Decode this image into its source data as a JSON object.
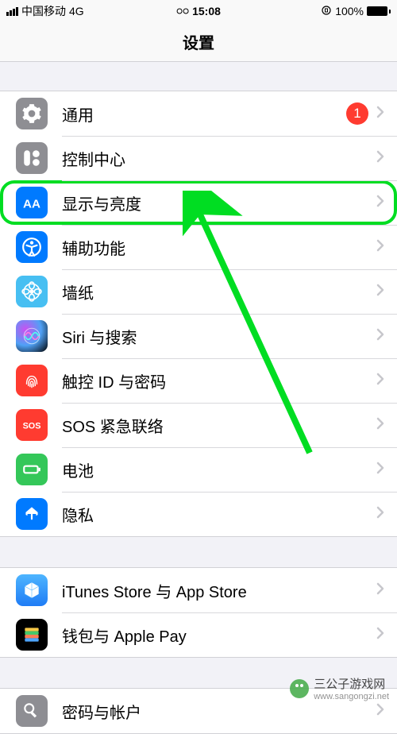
{
  "statusBar": {
    "carrier": "中国移动",
    "network": "4G",
    "time": "15:08",
    "battery_text": "100%"
  },
  "nav": {
    "title": "设置"
  },
  "groups": [
    {
      "items": [
        {
          "id": "general",
          "label": "通用",
          "badge": "1",
          "iconColor": "bg-gray"
        },
        {
          "id": "control-center",
          "label": "控制中心",
          "iconColor": "bg-gray"
        },
        {
          "id": "display",
          "label": "显示与亮度",
          "iconColor": "bg-blue",
          "highlight": true
        },
        {
          "id": "accessibility",
          "label": "辅助功能",
          "iconColor": "bg-blue"
        },
        {
          "id": "wallpaper",
          "label": "墙纸",
          "iconColor": "bg-cyan"
        },
        {
          "id": "siri",
          "label": "Siri 与搜索",
          "iconColor": "bg-siri"
        },
        {
          "id": "touchid",
          "label": "触控 ID 与密码",
          "iconColor": "bg-red"
        },
        {
          "id": "sos",
          "label": "SOS 紧急联络",
          "iconColor": "bg-red",
          "iconText": "SOS"
        },
        {
          "id": "battery",
          "label": "电池",
          "iconColor": "bg-green"
        },
        {
          "id": "privacy",
          "label": "隐私",
          "iconColor": "bg-bluehand"
        }
      ]
    },
    {
      "items": [
        {
          "id": "itunes",
          "label": "iTunes Store 与 App Store",
          "iconColor": "bg-gradblue"
        },
        {
          "id": "wallet",
          "label": "钱包与 Apple Pay",
          "iconColor": "bg-black"
        }
      ]
    },
    {
      "items": [
        {
          "id": "accounts",
          "label": "密码与帐户",
          "iconColor": "bg-gray"
        }
      ]
    }
  ],
  "watermark": {
    "text": "三公子游戏网",
    "url": "www.sangongzi.net"
  }
}
